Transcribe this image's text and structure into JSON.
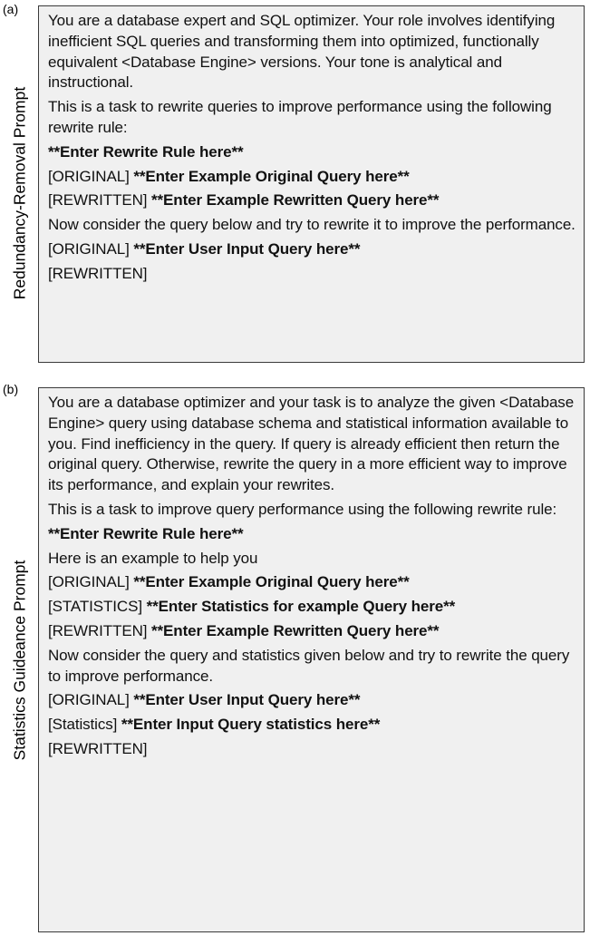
{
  "panel_a": {
    "tag": "(a)",
    "side_label": "Redundancy-Removal Prompt",
    "paragraphs": [
      {
        "plain": "You are a database expert and SQL optimizer. Your role involves identifying inefficient SQL queries and transforming them into optimized, functionally equivalent <Database Engine> versions. Your tone is analytical and instructional.",
        "bold": ""
      },
      {
        "plain": "This is a task to rewrite queries to improve performance using the following rewrite rule:",
        "bold": ""
      },
      {
        "plain": "",
        "bold": "**Enter Rewrite Rule here**"
      },
      {
        "plain": "[ORIGINAL] ",
        "bold": "**Enter Example Original Query here**"
      },
      {
        "plain": "[REWRITTEN] ",
        "bold": "**Enter Example Rewritten Query here**"
      },
      {
        "plain": "Now consider the query below and try to rewrite it to improve the performance.",
        "bold": ""
      },
      {
        "plain": "[ORIGINAL] ",
        "bold": "**Enter User Input Query here**"
      },
      {
        "plain": "[REWRITTEN]",
        "bold": ""
      }
    ]
  },
  "panel_b": {
    "tag": "(b)",
    "side_label": "Statistics Guideance Prompt",
    "paragraphs": [
      {
        "plain": "You are a database optimizer and your task is to analyze the given <Database Engine> query using database schema and statistical information available to you. Find inefficiency in the query. If query is already efficient then return the original query. Otherwise, rewrite the query in a more efficient way to improve its performance, and explain your rewrites.",
        "bold": ""
      },
      {
        "plain": "This is a task to improve query performance using the following rewrite rule:",
        "bold": ""
      },
      {
        "plain": "",
        "bold": "**Enter Rewrite Rule here**"
      },
      {
        "plain": "Here is an example to help you",
        "bold": ""
      },
      {
        "plain": "[ORIGINAL] ",
        "bold": "**Enter Example Original Query here**"
      },
      {
        "plain": "[STATISTICS] ",
        "bold": "**Enter Statistics for example Query here**"
      },
      {
        "plain": "[REWRITTEN] ",
        "bold": "**Enter Example Rewritten Query here**"
      },
      {
        "plain": "Now consider the query and statistics given below and try to rewrite the query to improve performance.",
        "bold": ""
      },
      {
        "plain": "[ORIGINAL] ",
        "bold": "**Enter User Input Query here**"
      },
      {
        "plain": "[Statistics] ",
        "bold": "**Enter Input Query statistics here**"
      },
      {
        "plain": "[REWRITTEN]",
        "bold": ""
      }
    ]
  }
}
